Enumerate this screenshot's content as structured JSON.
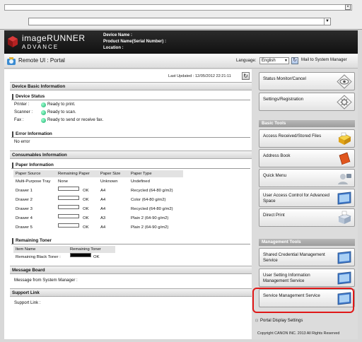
{
  "brand": {
    "line1": "imageRUNNER",
    "line2": "ADVANCE"
  },
  "device": {
    "name_label": "Device Name :",
    "product_label": "Product Name(Serial Number) :",
    "location_label": "Location :"
  },
  "titlebar": {
    "title": "Remote UI : Portal",
    "language_label": "Language:",
    "language_value": "English",
    "mail_link": "Mail to System Manager"
  },
  "last_updated": "Last Updated : 12/05/2012 22:21:11",
  "sections": {
    "device_basic": "Device Basic Information",
    "device_status": "Device Status",
    "error_info": "Error Information",
    "consumables": "Consumables Information",
    "paper_info": "Paper Information",
    "remaining_toner": "Remaining Toner",
    "message_board": "Message Board",
    "support_link": "Support Link"
  },
  "status": [
    {
      "label": "Printer :",
      "value": "Ready to print."
    },
    {
      "label": "Scanner :",
      "value": "Ready to scan."
    },
    {
      "label": "Fax :",
      "value": "Ready to send or receive fax."
    }
  ],
  "error_text": "No error",
  "paper": {
    "headers": [
      "Paper Source",
      "Remaining Paper",
      "Paper Size",
      "Paper Type"
    ],
    "rows": [
      {
        "source": "Multi-Purpose Tray",
        "remaining": "None",
        "gauge": false,
        "size": "Unknown",
        "type": "Undefined"
      },
      {
        "source": "Drawer 1",
        "remaining": "OK",
        "gauge": true,
        "size": "A4",
        "type": "Recycled (64-80 g/m2)"
      },
      {
        "source": "Drawer 2",
        "remaining": "OK",
        "gauge": true,
        "size": "A4",
        "type": "Color (64-80 g/m2)"
      },
      {
        "source": "Drawer 3",
        "remaining": "OK",
        "gauge": true,
        "size": "A4",
        "type": "Recycled (64-80 g/m2)"
      },
      {
        "source": "Drawer 4",
        "remaining": "OK",
        "gauge": true,
        "size": "A3",
        "type": "Plain 2 (64-90 g/m2)"
      },
      {
        "source": "Drawer 5",
        "remaining": "OK",
        "gauge": true,
        "size": "A4",
        "type": "Plain 2 (64-90 g/m2)"
      }
    ]
  },
  "toner": {
    "headers": [
      "Item Name",
      "Remaining Toner"
    ],
    "item": "Remaining Black Toner :",
    "value": "OK"
  },
  "message_text": "Message from System Manager :",
  "support_text": "Support Link :",
  "sidebar": {
    "top": [
      {
        "label": "Status Monitor/Cancel",
        "icon": "eye-icon"
      },
      {
        "label": "Settings/Registration",
        "icon": "gear-icon"
      }
    ],
    "basic_tools_title": "Basic Tools",
    "basic_tools": [
      {
        "label": "Access Received/Stored Files",
        "icon": "folder-icon"
      },
      {
        "label": "Address Book",
        "icon": "book-icon"
      },
      {
        "label": "Quick Menu",
        "icon": "user-icon"
      },
      {
        "label": "User Access Control for Advanced Space",
        "icon": "monitor-icon"
      },
      {
        "label": "Direct Print",
        "icon": "printer-icon"
      }
    ],
    "management_tools_title": "Management Tools",
    "management_tools": [
      {
        "label": "Shared Credential Management Service",
        "icon": "monitor-icon"
      },
      {
        "label": "User Setting Information Management Service",
        "icon": "monitor-icon"
      },
      {
        "label": "Service Management Service",
        "icon": "monitor-icon"
      }
    ],
    "portal_display": "Portal Display Settings",
    "copyright": "Copyright CANON INC. 2013 All Rights Reserved"
  },
  "colors": {
    "highlight": "#e01818",
    "status_dot": "#18b070"
  }
}
